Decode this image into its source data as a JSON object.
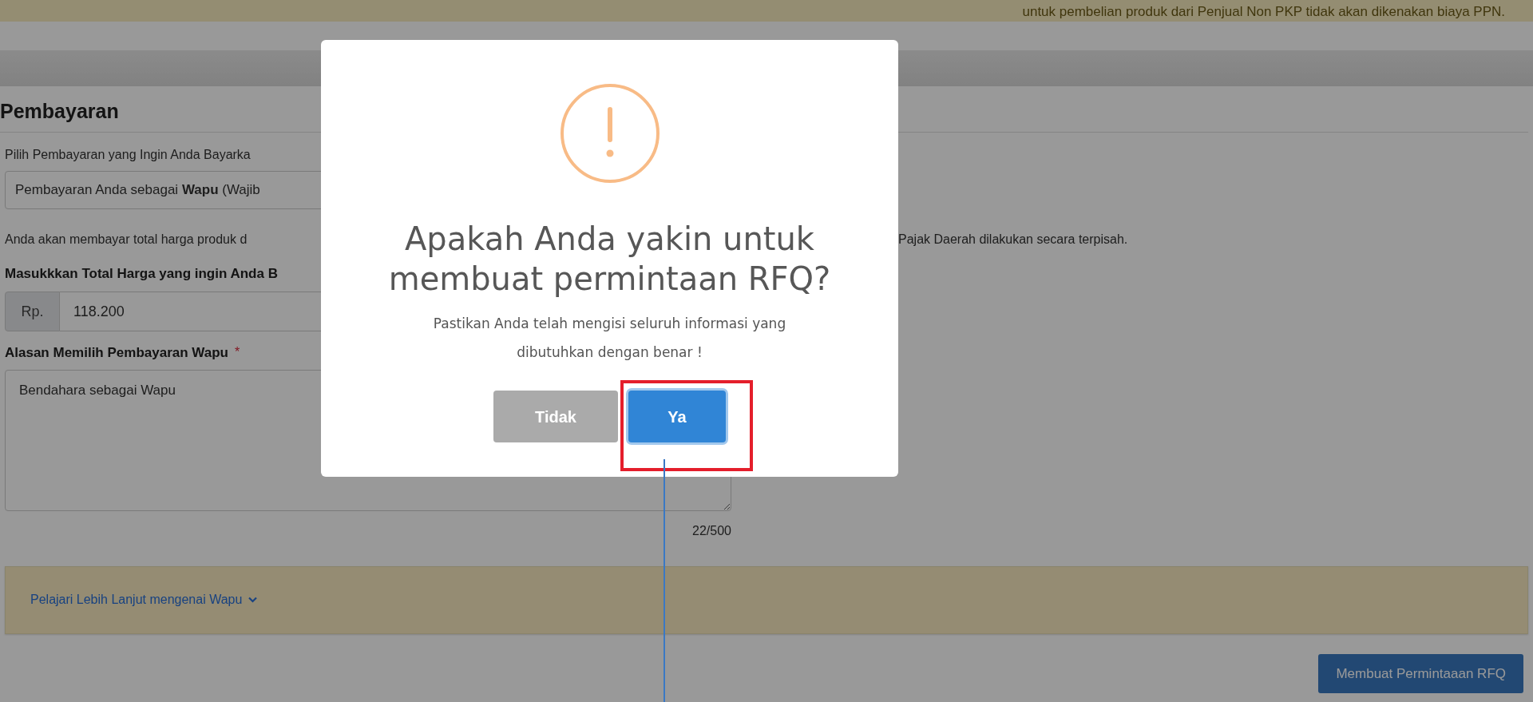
{
  "banner": {
    "text": "untuk pembelian produk dari Penjual Non PKP tidak akan dikenakan biaya PPN."
  },
  "section": {
    "title": "Pembayaran"
  },
  "payment_prompt": "Pilih Pembayaran yang Ingin Anda Bayarka",
  "payment_select": {
    "value": "Pembayaran Anda sebagai **Wapu** (Wajib"
  },
  "info_text_left": "Anda akan membayar total harga produk d",
  "info_text_right": "Pajak Daerah dilakukan secara terpisah.",
  "total_field": {
    "label": "Masukkkan Total Harga yang ingin Anda B",
    "prefix": "Rp.",
    "value": "118.200"
  },
  "reason_field": {
    "label": "Alasan Memilih Pembayaran Wapu",
    "required_mark": "*",
    "value": "Bendahara sebagai Wapu",
    "counter": "22/500"
  },
  "learn_more": {
    "label": "Pelajari Lebih Lanjut mengenai Wapu",
    "expanded": false
  },
  "submit_button": {
    "label": "Membuat Permintaaan RFQ"
  },
  "dialog": {
    "title": "Apakah Anda yakin untuk membuat permintaan RFQ?",
    "message": "Pastikan Anda telah mengisi seluruh informasi yang dibutuhkan dengan benar !",
    "buttons": [
      {
        "label": "Tidak",
        "kind": "cancel",
        "focused": false
      },
      {
        "label": "Ya",
        "kind": "confirm",
        "focused": true
      }
    ]
  }
}
